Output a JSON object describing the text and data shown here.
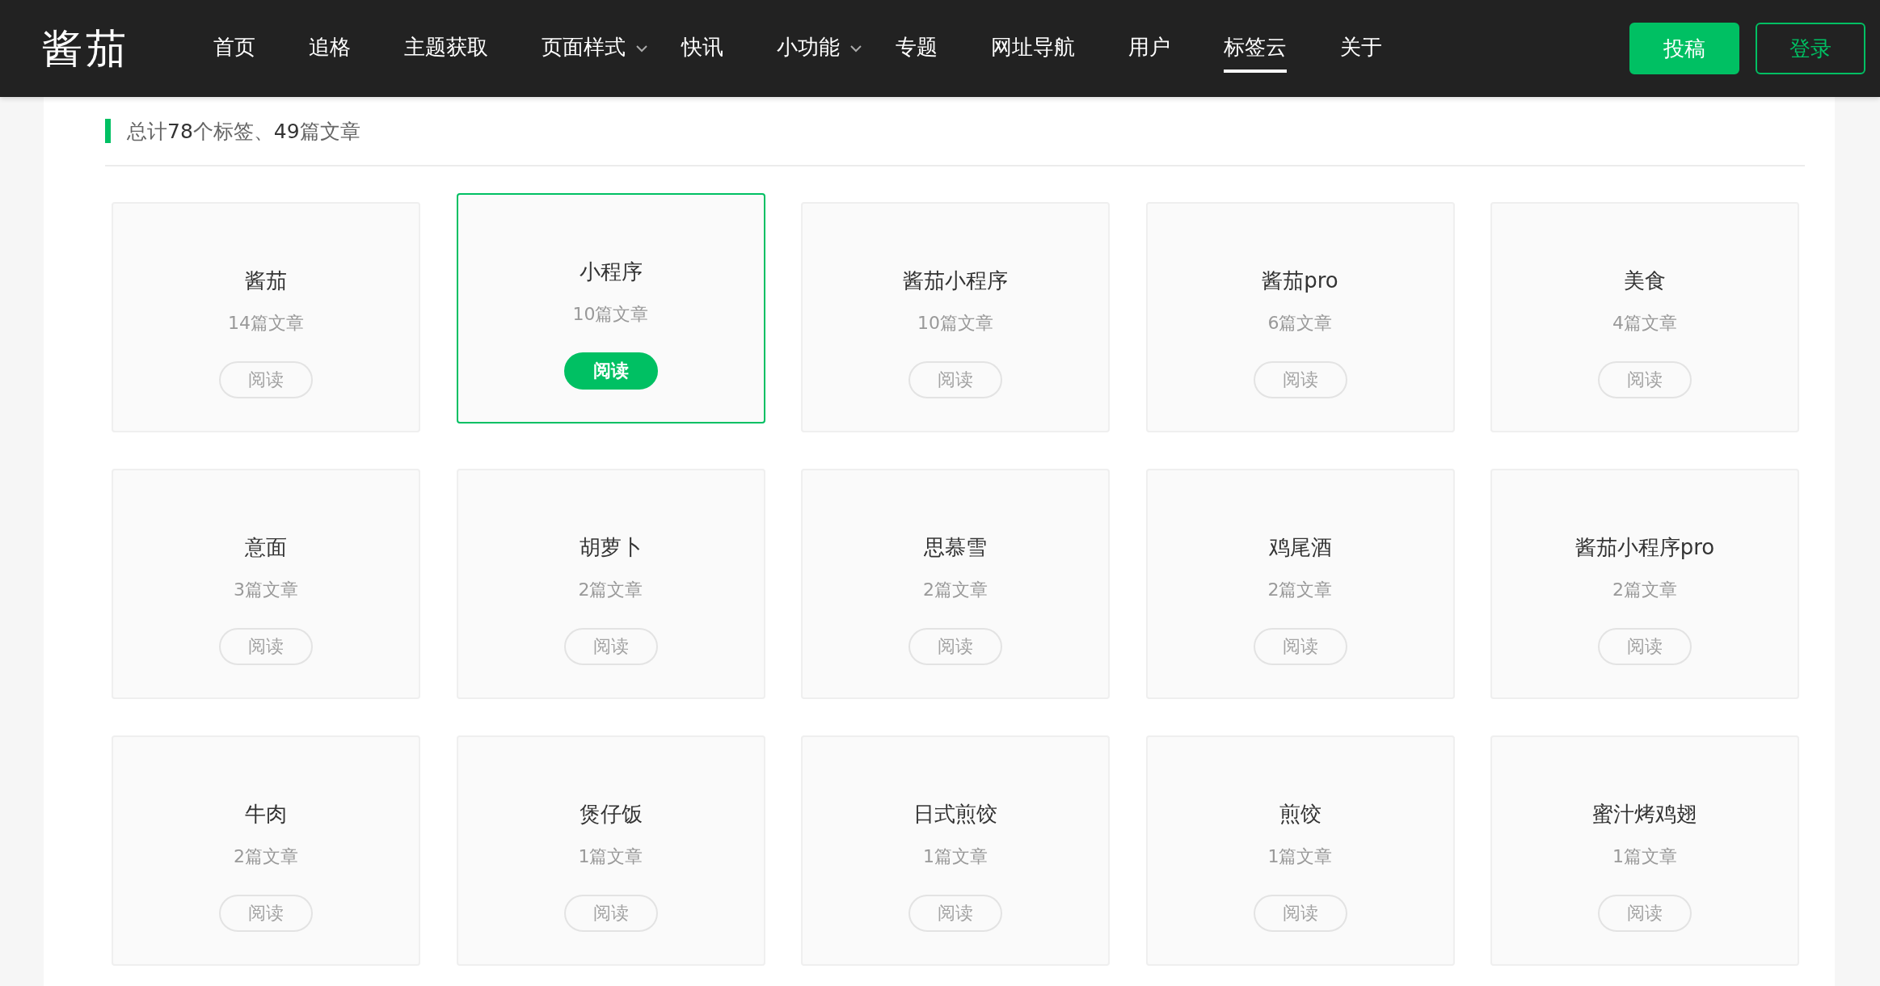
{
  "logo": "酱茄",
  "nav": [
    {
      "label": "首页",
      "selected": false,
      "dropdown": false
    },
    {
      "label": "追格",
      "selected": false,
      "dropdown": false
    },
    {
      "label": "主题获取",
      "selected": false,
      "dropdown": false
    },
    {
      "label": "页面样式",
      "selected": false,
      "dropdown": true
    },
    {
      "label": "快讯",
      "selected": false,
      "dropdown": false
    },
    {
      "label": "小功能",
      "selected": false,
      "dropdown": true
    },
    {
      "label": "专题",
      "selected": false,
      "dropdown": false
    },
    {
      "label": "网址导航",
      "selected": false,
      "dropdown": false
    },
    {
      "label": "用户",
      "selected": false,
      "dropdown": false
    },
    {
      "label": "标签云",
      "selected": true,
      "dropdown": false
    },
    {
      "label": "关于",
      "selected": false,
      "dropdown": false
    }
  ],
  "actions": [
    {
      "label": "投稿",
      "kind": "primary"
    },
    {
      "label": "登录",
      "kind": "outline"
    }
  ],
  "summary": "总计**78**个标签、**49**篇文章",
  "tags": [
    {
      "name": "酱茄",
      "count": "14篇文章",
      "button": "阅读",
      "highlighted": false
    },
    {
      "name": "小程序",
      "count": "10篇文章",
      "button": "阅读",
      "highlighted": true
    },
    {
      "name": "酱茄小程序",
      "count": "10篇文章",
      "button": "阅读",
      "highlighted": false
    },
    {
      "name": "酱茄pro",
      "count": "6篇文章",
      "button": "阅读",
      "highlighted": false
    },
    {
      "name": "美食",
      "count": "4篇文章",
      "button": "阅读",
      "highlighted": false
    },
    {
      "name": "意面",
      "count": "3篇文章",
      "button": "阅读",
      "highlighted": false
    },
    {
      "name": "胡萝卜",
      "count": "2篇文章",
      "button": "阅读",
      "highlighted": false
    },
    {
      "name": "思慕雪",
      "count": "2篇文章",
      "button": "阅读",
      "highlighted": false
    },
    {
      "name": "鸡尾酒",
      "count": "2篇文章",
      "button": "阅读",
      "highlighted": false
    },
    {
      "name": "酱茄小程序pro",
      "count": "2篇文章",
      "button": "阅读",
      "highlighted": false
    },
    {
      "name": "牛肉",
      "count": "2篇文章",
      "button": "阅读",
      "highlighted": false
    },
    {
      "name": "煲仔饭",
      "count": "1篇文章",
      "button": "阅读",
      "highlighted": false
    },
    {
      "name": "日式煎饺",
      "count": "1篇文章",
      "button": "阅读",
      "highlighted": false
    },
    {
      "name": "煎饺",
      "count": "1篇文章",
      "button": "阅读",
      "highlighted": false
    },
    {
      "name": "蜜汁烤鸡翅",
      "count": "1篇文章",
      "button": "阅读",
      "highlighted": false
    }
  ]
}
